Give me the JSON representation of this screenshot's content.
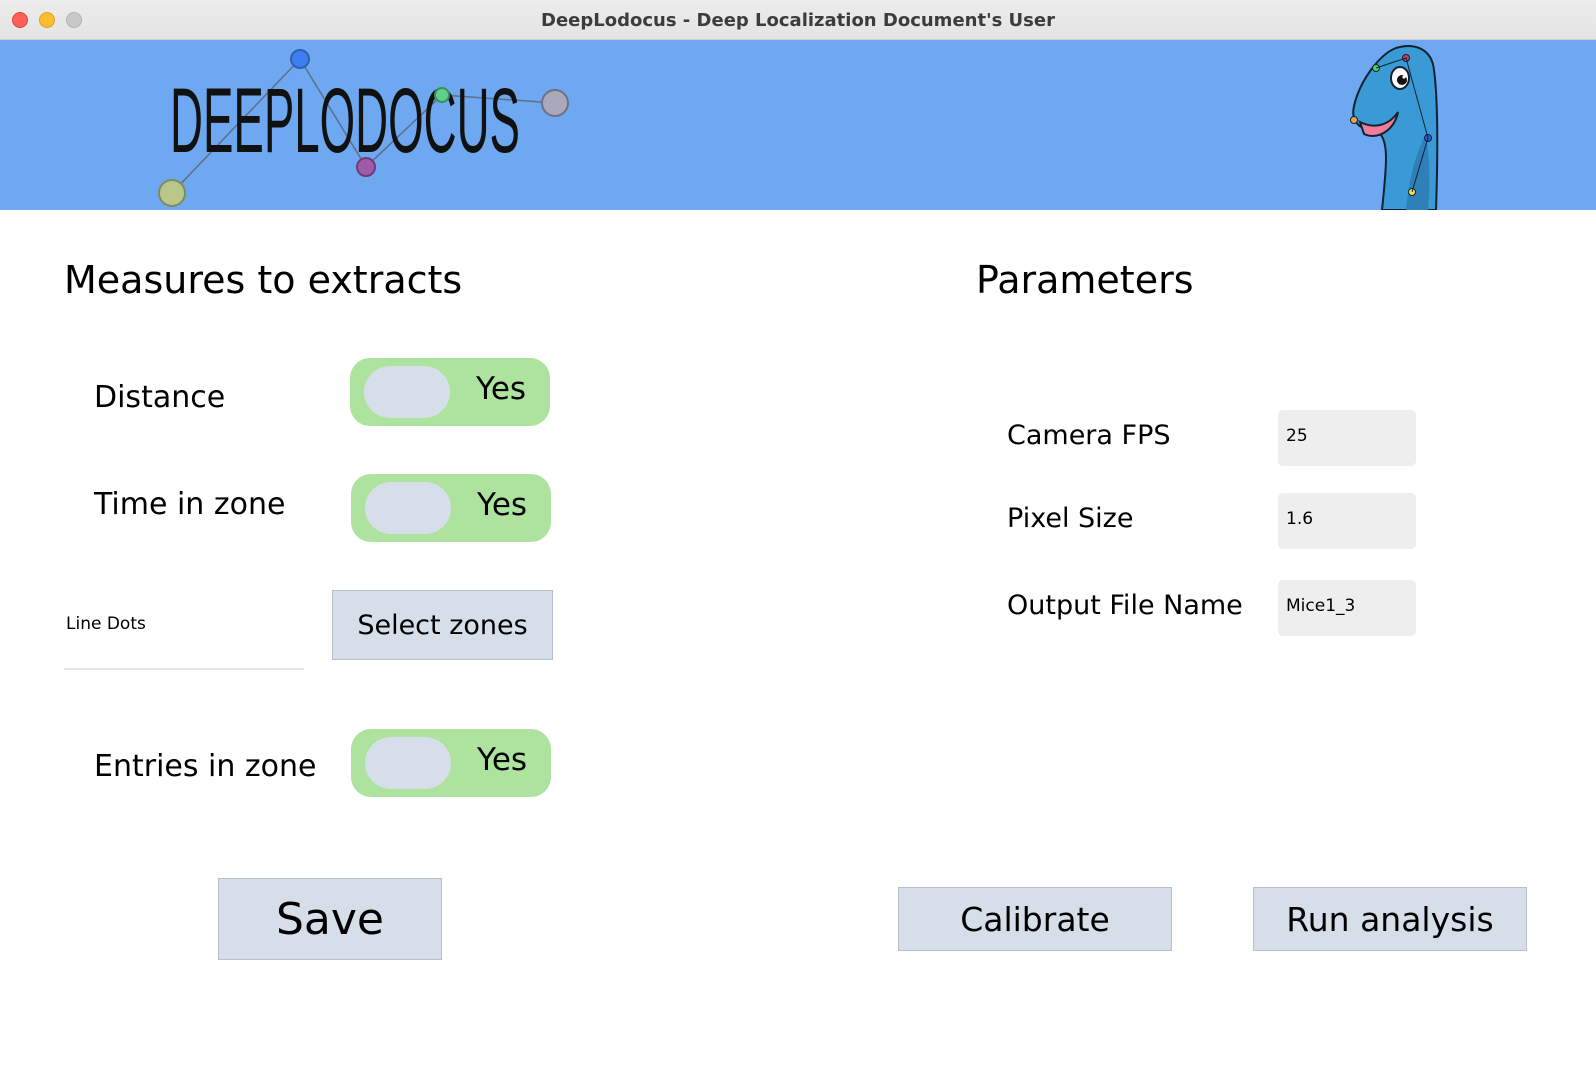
{
  "window": {
    "title": "DeepLodocus - Deep Localization Document's User"
  },
  "banner": {
    "logo_text": "DEEPLODOCUS",
    "background": "#6ea8f0"
  },
  "measures": {
    "heading": "Measures to extracts",
    "distance": {
      "label": "Distance",
      "toggle": "Yes"
    },
    "time_in_zone": {
      "label": "Time in zone",
      "toggle": "Yes"
    },
    "zones": {
      "value": "Line Dots",
      "button": "Select zones"
    },
    "entries_in_zone": {
      "label": "Entries in zone",
      "toggle": "Yes"
    },
    "save_button": "Save"
  },
  "parameters": {
    "heading": "Parameters",
    "camera_fps": {
      "label": "Camera FPS",
      "value": "25"
    },
    "pixel_size": {
      "label": "Pixel Size",
      "value": "1.6"
    },
    "output_file": {
      "label": "Output File Name",
      "value": "Mice1_3"
    }
  },
  "actions": {
    "calibrate": "Calibrate",
    "run_analysis": "Run analysis"
  },
  "colors": {
    "toggle_on": "#aee29f",
    "button": "#d6deea",
    "field": "#eeeeee"
  }
}
